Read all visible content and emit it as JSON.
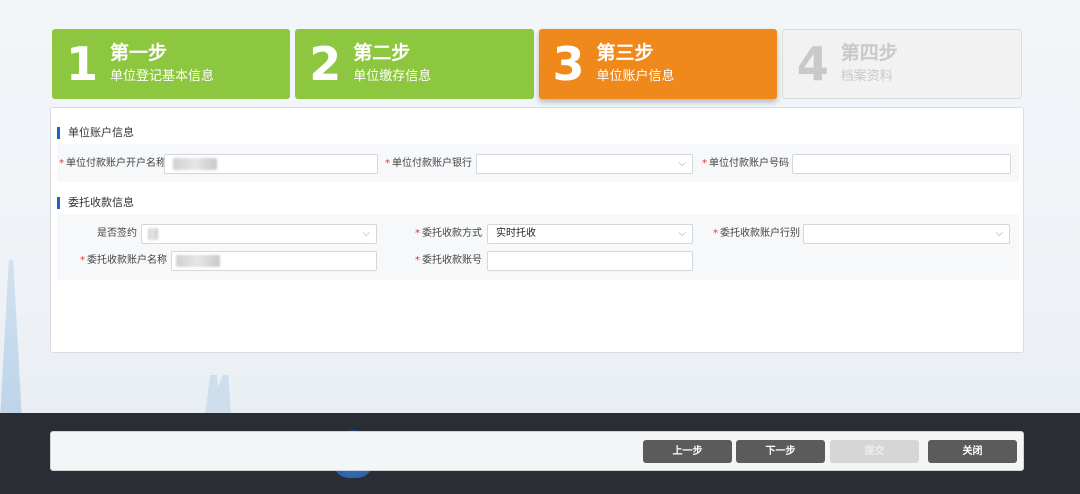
{
  "steps": [
    {
      "num": "1",
      "title": "第一步",
      "sub": "单位登记基本信息",
      "state": "done"
    },
    {
      "num": "2",
      "title": "第二步",
      "sub": "单位缴存信息",
      "state": "done"
    },
    {
      "num": "3",
      "title": "第三步",
      "sub": "单位账户信息",
      "state": "active"
    },
    {
      "num": "4",
      "title": "第四步",
      "sub": "档案资料",
      "state": "todo"
    }
  ],
  "section_account": {
    "title": "单位账户信息",
    "account_name_label": "单位付款账户开户名称",
    "bank_label": "单位付款账户银行",
    "account_no_label": "单位付款账户号码"
  },
  "section_entrust": {
    "title": "委托收款信息",
    "signed_label": "是否签约",
    "method_label": "委托收款方式",
    "method_value": "实时托收",
    "bank_type_label": "委托收款账户行别",
    "entrust_name_label": "委托收款账户名称",
    "entrust_no_label": "委托收款账号"
  },
  "buttons": {
    "prev": "上一步",
    "next": "下一步",
    "submit": "提交",
    "close": "关闭"
  },
  "colors": {
    "done": "#8dc63f",
    "active": "#f0891c",
    "todo": "#f2f2f2",
    "accent": "#1a66c4",
    "required": "#e33333"
  }
}
